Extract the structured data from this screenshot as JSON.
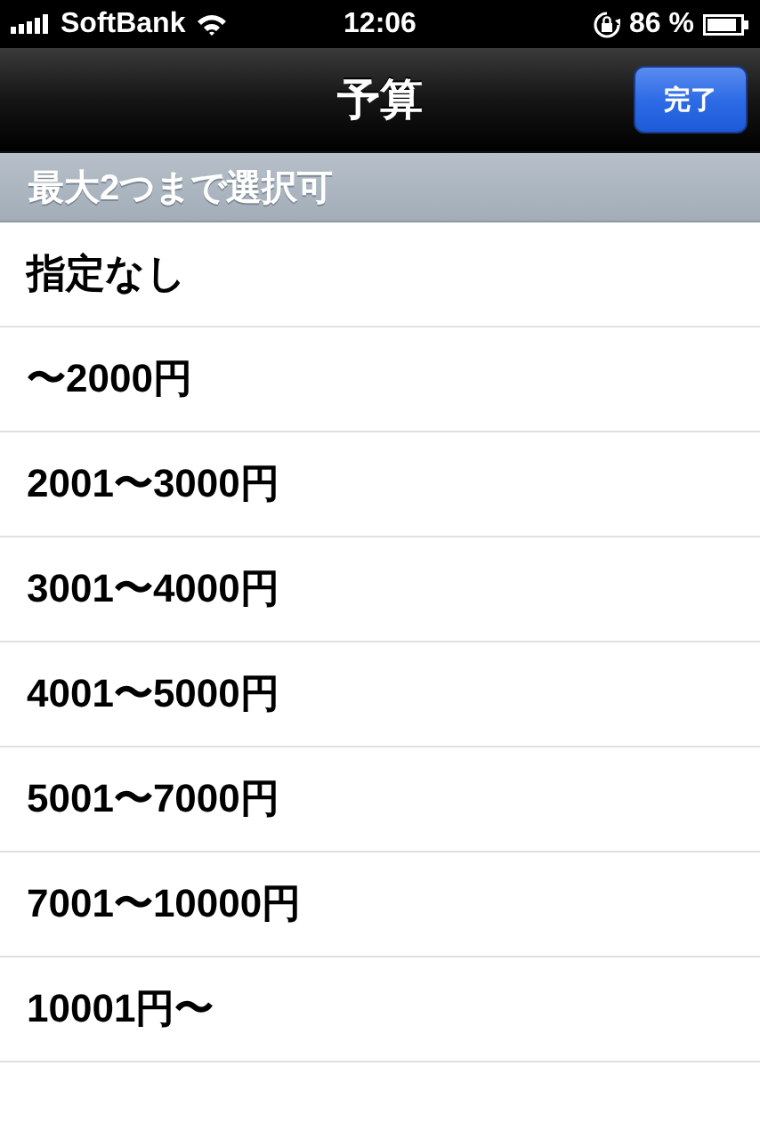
{
  "status_bar": {
    "carrier": "SoftBank",
    "time": "12:06",
    "battery": "86 %"
  },
  "nav_bar": {
    "title": "予算",
    "done_button": "完了"
  },
  "section": {
    "header": "最大2つまで選択可",
    "items": [
      {
        "label": "指定なし",
        "selected": false
      },
      {
        "label": "〜2000円",
        "selected": false
      },
      {
        "label": "2001〜3000円",
        "selected": false
      },
      {
        "label": "3001〜4000円",
        "selected": false
      },
      {
        "label": "4001〜5000円",
        "selected": false
      },
      {
        "label": "5001〜7000円",
        "selected": false
      },
      {
        "label": "7001〜10000円",
        "selected": false
      },
      {
        "label": "10001円〜",
        "selected": false
      }
    ]
  }
}
